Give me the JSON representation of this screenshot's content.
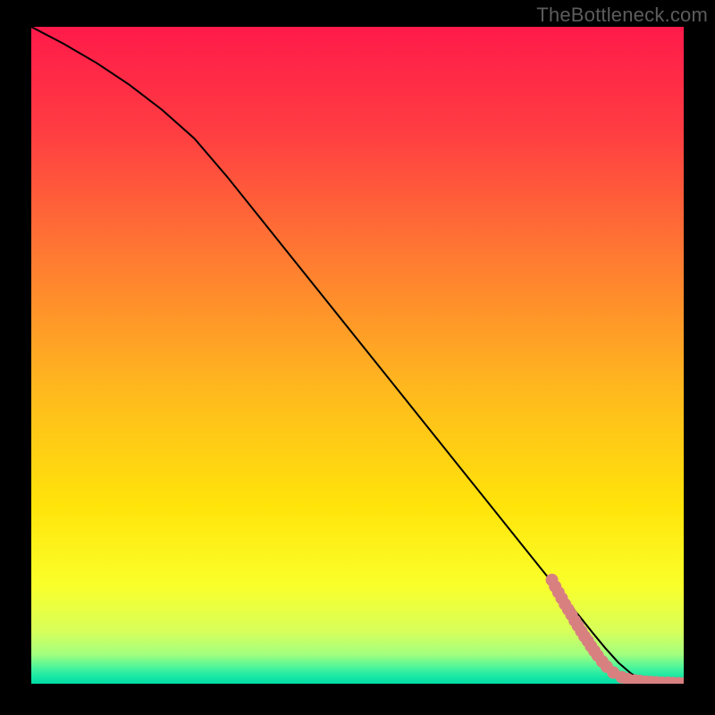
{
  "attribution": "TheBottleneck.com",
  "chart_data": {
    "type": "line",
    "title": "",
    "xlabel": "",
    "ylabel": "",
    "xlim": [
      0,
      100
    ],
    "ylim": [
      0,
      100
    ],
    "grid": false,
    "legend": false,
    "background_gradient": {
      "type": "vertical",
      "stops": [
        {
          "offset": 0.0,
          "color": "#ff1a4a"
        },
        {
          "offset": 0.16,
          "color": "#ff3d42"
        },
        {
          "offset": 0.35,
          "color": "#ff7a32"
        },
        {
          "offset": 0.55,
          "color": "#ffb81e"
        },
        {
          "offset": 0.73,
          "color": "#ffe40a"
        },
        {
          "offset": 0.85,
          "color": "#faff2a"
        },
        {
          "offset": 0.92,
          "color": "#d7ff5a"
        },
        {
          "offset": 0.955,
          "color": "#a4ff7e"
        },
        {
          "offset": 0.975,
          "color": "#4cf59a"
        },
        {
          "offset": 0.99,
          "color": "#16e6a5"
        },
        {
          "offset": 1.0,
          "color": "#00dca4"
        }
      ]
    },
    "series": [
      {
        "name": "bottleneck-curve",
        "color": "#000000",
        "stroke_width": 2,
        "x": [
          0,
          5,
          10,
          15,
          20,
          25,
          30,
          35,
          40,
          45,
          50,
          55,
          60,
          65,
          70,
          75,
          80,
          82,
          84,
          86,
          88,
          90,
          92,
          94,
          96,
          98,
          100
        ],
        "values": [
          100,
          97.4,
          94.5,
          91.2,
          87.4,
          83.0,
          77.2,
          71.0,
          64.8,
          58.6,
          52.4,
          46.2,
          40.0,
          33.8,
          27.6,
          21.4,
          15.2,
          12.7,
          10.3,
          7.8,
          5.4,
          3.2,
          1.5,
          0.6,
          0.2,
          0.1,
          0.0
        ]
      }
    ],
    "scatter_zone": {
      "name": "gpu-points",
      "color": "#d88080",
      "points": [
        {
          "x": 79.8,
          "y": 15.8
        },
        {
          "x": 80.3,
          "y": 14.8
        },
        {
          "x": 80.8,
          "y": 13.9
        },
        {
          "x": 81.3,
          "y": 13.0
        },
        {
          "x": 81.8,
          "y": 12.1
        },
        {
          "x": 82.3,
          "y": 11.3
        },
        {
          "x": 82.8,
          "y": 10.5
        },
        {
          "x": 83.3,
          "y": 9.6
        },
        {
          "x": 83.8,
          "y": 8.8
        },
        {
          "x": 84.3,
          "y": 8.0
        },
        {
          "x": 84.8,
          "y": 7.2
        },
        {
          "x": 85.3,
          "y": 6.5
        },
        {
          "x": 85.8,
          "y": 5.7
        },
        {
          "x": 86.3,
          "y": 5.0
        },
        {
          "x": 86.8,
          "y": 4.3
        },
        {
          "x": 87.5,
          "y": 3.4
        },
        {
          "x": 88.2,
          "y": 2.6
        },
        {
          "x": 89.2,
          "y": 1.7
        },
        {
          "x": 90.5,
          "y": 1.0
        },
        {
          "x": 91.4,
          "y": 0.7
        },
        {
          "x": 92.5,
          "y": 0.5
        },
        {
          "x": 93.3,
          "y": 0.4
        },
        {
          "x": 94.2,
          "y": 0.3
        },
        {
          "x": 95.0,
          "y": 0.25
        },
        {
          "x": 95.8,
          "y": 0.2
        },
        {
          "x": 96.7,
          "y": 0.16
        },
        {
          "x": 97.6,
          "y": 0.13
        },
        {
          "x": 98.4,
          "y": 0.1
        },
        {
          "x": 99.2,
          "y": 0.07
        },
        {
          "x": 100.0,
          "y": 0.05
        }
      ]
    }
  },
  "colors": {
    "frame": "#000000",
    "line": "#000000",
    "dots": "#d88080"
  }
}
